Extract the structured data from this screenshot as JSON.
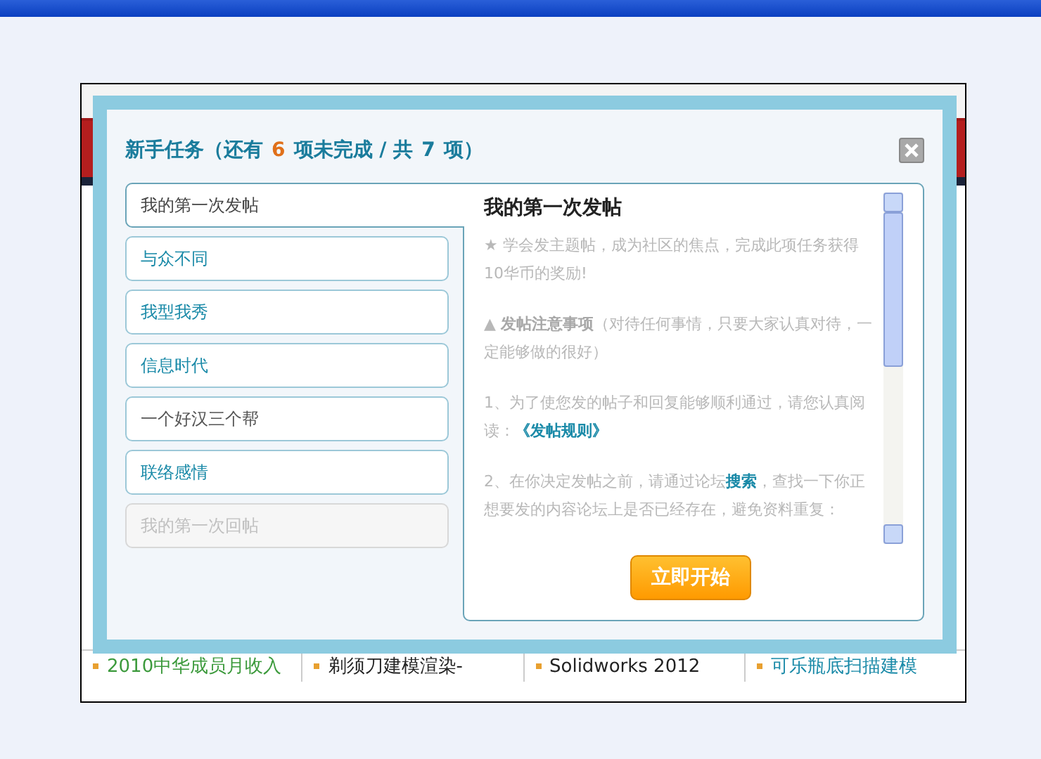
{
  "dialog": {
    "title": {
      "prefix": "新手任务（还有",
      "remaining": "6",
      "middle": "项未完成 / 共",
      "total": "7",
      "suffix": "项）"
    },
    "tasks": [
      {
        "label": "我的第一次发帖",
        "selected": true,
        "completed": false,
        "disabled": false
      },
      {
        "label": "与众不同",
        "selected": false,
        "completed": false,
        "disabled": false
      },
      {
        "label": "我型我秀",
        "selected": false,
        "completed": false,
        "disabled": false
      },
      {
        "label": "信息时代",
        "selected": false,
        "completed": false,
        "disabled": false
      },
      {
        "label": "一个好汉三个帮",
        "selected": false,
        "completed": true,
        "disabled": false
      },
      {
        "label": "联络感情",
        "selected": false,
        "completed": false,
        "disabled": false
      },
      {
        "label": "我的第一次回帖",
        "selected": false,
        "completed": false,
        "disabled": true
      }
    ],
    "detail": {
      "heading": "我的第一次发帖",
      "paragraphs": [
        [
          {
            "kind": "text",
            "text": "★ 学会发主题帖，成为社区的焦点，完成此项任务获得10华币的奖励!"
          }
        ],
        [
          {
            "kind": "text",
            "text": "▲ **发帖注意事项**（对待任何事情，只要大家认真对待，一定能够做的很好）"
          }
        ],
        [
          {
            "kind": "text",
            "text": "1、为了使您发的帖子和回复能够顺利通过，请您认真阅读："
          },
          {
            "kind": "link",
            "text": "《发帖规则》"
          }
        ],
        [
          {
            "kind": "text",
            "text": "2、在你决定发帖之前，请通过论坛"
          },
          {
            "kind": "link",
            "text": "搜索"
          },
          {
            "kind": "text",
            "text": "，查找一下你正想要发的内容论坛上是否已经存在，避免资料重复："
          }
        ]
      ],
      "start_button": "立即开始"
    }
  },
  "background_links": [
    {
      "text": "2010中华成员月收入",
      "color": "#3c9a3c"
    },
    {
      "text": "剃须刀建模渲染-",
      "color": "#222222"
    },
    {
      "text": "Solidworks 2012",
      "color": "#222222"
    },
    {
      "text": "可乐瓶底扫描建模",
      "color": "#1a8aa8"
    }
  ]
}
